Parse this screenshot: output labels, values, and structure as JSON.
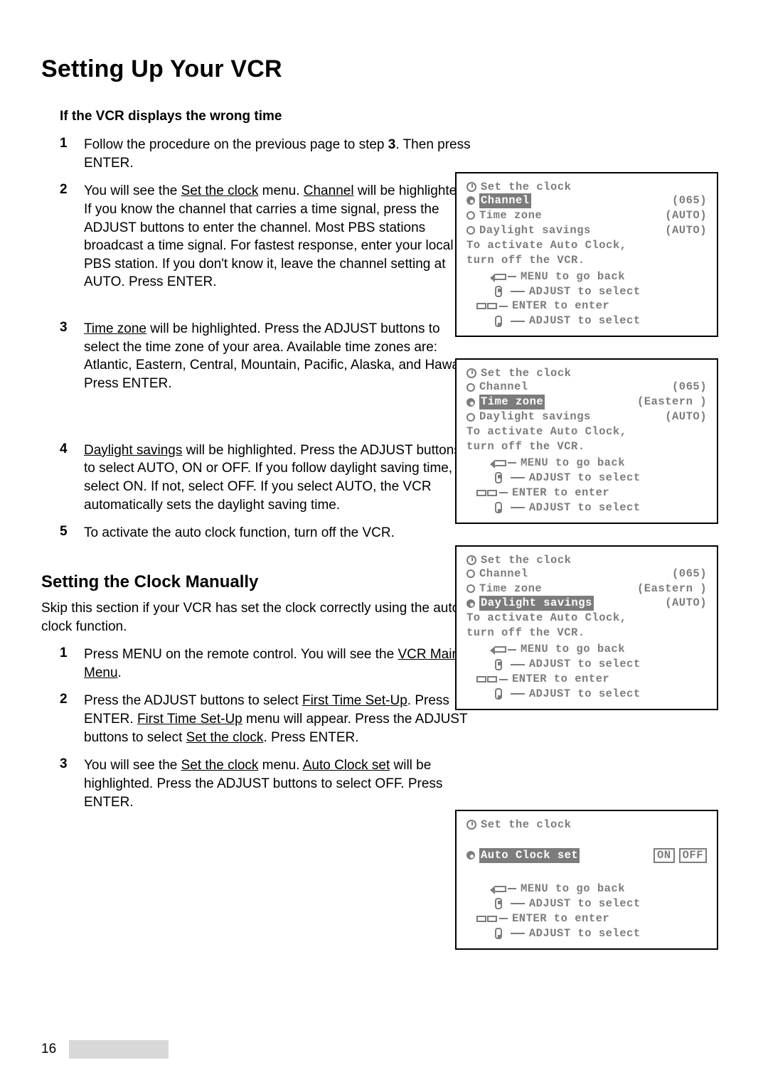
{
  "page": {
    "number": "16",
    "title": "Setting Up Your VCR"
  },
  "sectionA": {
    "heading": "If the VCR displays the wrong time",
    "steps": [
      {
        "num": "1",
        "pre": "Follow the procedure on the previous page to step ",
        "bold": "3",
        "post": ".  Then press ENTER."
      },
      {
        "num": "2",
        "u1": "Set the clock",
        "u2": "Channel",
        "t1": "You will see the ",
        "t2": " menu.  ",
        "t3": " will be highlighted.  If you know the channel that carries a time signal, press the ADJUST buttons to enter the channel.  Most PBS stations broadcast a time signal.  For fastest response, enter your local PBS station.  If you don't know it, leave the channel setting at AUTO.  Press ENTER."
      },
      {
        "num": "3",
        "u1": "Time zone",
        "t1": "",
        "t2": " will be highlighted.  Press the ADJUST buttons to select the time zone of your area.  Available time zones are: Atlantic, Eastern, Central, Mountain, Pacific, Alaska, and Hawaii.  Press ENTER."
      },
      {
        "num": "4",
        "u1": "Daylight savings",
        "t1": "",
        "t2": " will be highlighted.  Press the ADJUST buttons to select AUTO, ON or OFF.  If you follow daylight saving time, select ON.  If not, select OFF.  If you select AUTO, the VCR automatically sets the daylight saving time."
      },
      {
        "num": "5",
        "plain": "To activate the auto clock function, turn off the VCR."
      }
    ]
  },
  "sectionB": {
    "heading": "Setting the Clock Manually",
    "intro": "Skip this section if your VCR has set the clock correctly using the auto clock function.",
    "steps": [
      {
        "num": "1",
        "t1": "Press MENU on the remote control.  You will see the ",
        "u1": "VCR Main Menu",
        "t2": "."
      },
      {
        "num": "2",
        "t1": "Press the ADJUST buttons to select ",
        "u1": "First Time Set-Up",
        "t2": ".  Press ENTER.  ",
        "u2": "First Time Set-Up",
        "t3": " menu will appear.  Press the ADJUST buttons to select ",
        "u3": "Set the clock",
        "t4": ".  Press ENTER."
      },
      {
        "num": "3",
        "t1": "You will see the ",
        "u1": "Set the clock",
        "t2": " menu.  ",
        "u2": "Auto Clock set",
        "t3": " will be highlighted.  Press the ADJUST buttons to select OFF.  Press ENTER."
      }
    ]
  },
  "osd": {
    "title": "Set the clock",
    "channel_label": "Channel",
    "channel_val": "(065)",
    "tz_label": "Time zone",
    "tz_auto": "(AUTO)",
    "tz_east": "(Eastern )",
    "ds_label": "Daylight savings",
    "ds_val": "(AUTO)",
    "note1": "To activate Auto Clock,",
    "note2": "turn off the VCR.",
    "hint_menu": "MENU to go back",
    "hint_adjust": "ADJUST to select",
    "hint_enter": "ENTER  to enter",
    "auto_clock": "Auto Clock set",
    "on": "ON",
    "off": "OFF"
  }
}
